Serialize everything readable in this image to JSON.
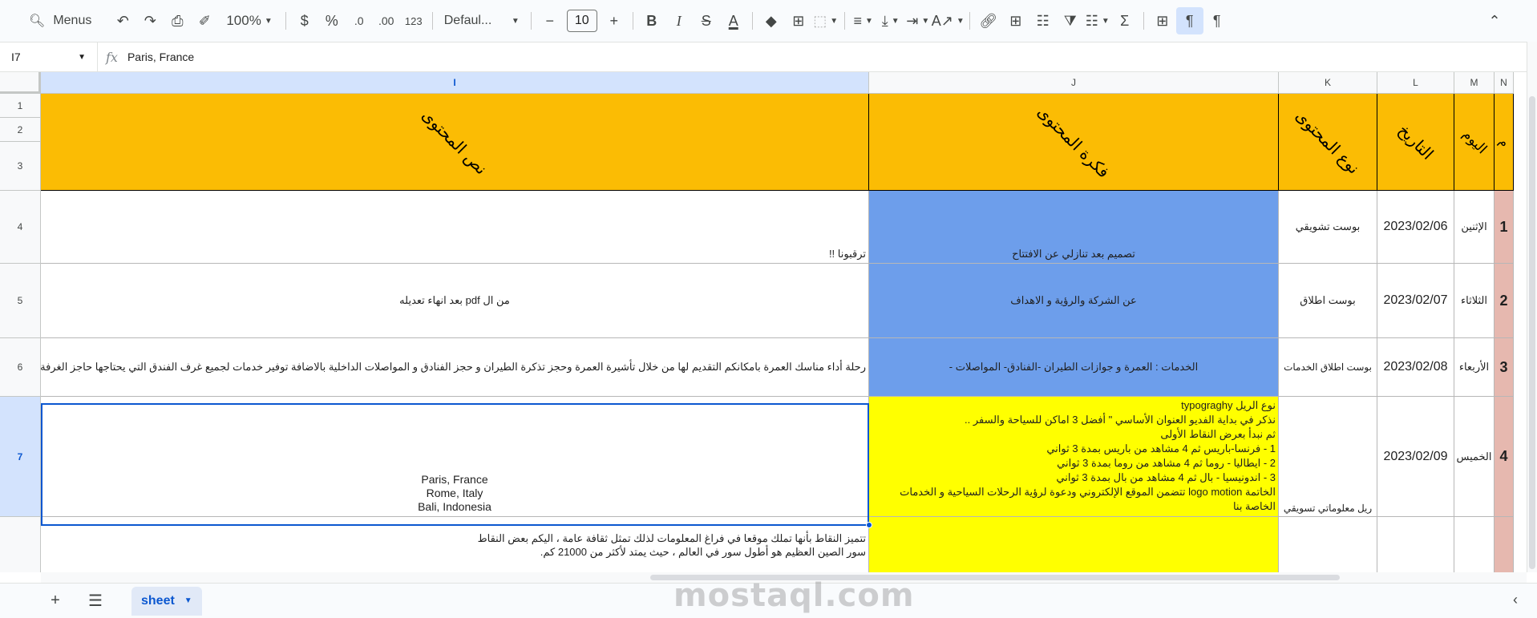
{
  "toolbar": {
    "menus_label": "Menus",
    "zoom": "100%",
    "font": "Defaul...",
    "font_size": "10",
    "currency": "$",
    "percent": "%",
    "dec_decrease": ".0",
    "dec_increase": ".00",
    "number_format": "123"
  },
  "formula_bar": {
    "cell_ref": "I7",
    "fx": "fx",
    "value": "Paris, France"
  },
  "columns": [
    "I",
    "J",
    "K",
    "L",
    "M",
    "N"
  ],
  "rows": [
    "1",
    "2",
    "3",
    "4",
    "5",
    "6",
    "7"
  ],
  "headers": {
    "I": "نص المحتوى",
    "J": "فكرة المحتوى",
    "K": "نوع المحتوى",
    "L": "التاريخ",
    "M": "اليوم",
    "N": "م"
  },
  "table": [
    {
      "I": "ترقبونا !!",
      "J": "تصميم بعد تنازلي  عن الافتتاح",
      "K": "بوست تشويقي",
      "L": "2023/02/06",
      "M": "الإثنين",
      "N": "1"
    },
    {
      "I": "من ال  pdf بعد انهاء تعديله",
      "J": "عن الشركة والرؤية و الاهداف",
      "K": "بوست اطلاق",
      "L": "2023/02/07",
      "M": "الثلاثاء",
      "N": "2"
    },
    {
      "I": "رحلة أداء مناسك العمرة بامكانكم التقديم لها من خلال تأشيرة العمرة وحجز تذكرة الطيران و حجز الفنادق و المواصلات الداخلية بالاضافة توفير خدمات لجميع غرف الفندق التي يحتاجها حاجز الغرفة بالاضافة لتوفير المو",
      "J": "الخدمات : العمرة و جوازات الطيران -الفنادق- المواصلات -",
      "K": "بوست اطلاق الخدمات",
      "L": "2023/02/08",
      "M": "الأربعاء",
      "N": "3"
    },
    {
      "I": "Paris, France\nRome, Italy\nBali, Indonesia",
      "J": "نوع الريل typograghy\nنذكر في بداية الفديو العنوان الأساسي \" أفضل 3 اماكن للسياحة والسفر ..\nثم نبدأ بعرض النقاط الأولى\n1 - فرنسا-باريس ثم 4 مشاهد من باريس  بمدة 3 ثواني\n2 - ايطاليا - روما ثم 4 مشاهد من روما بمدة 3 ثواني\n3 - اندونيسيا - بال ثم 4 مشاهد من بال بمدة 3 ثواني\nالخاتمة logo motion تتضمن الموقع الإلكتروني ودعوة لرؤية الرحلات السياحية و الخدمات الخاصة بنا",
      "K": "ريل  معلوماتي تسويقي",
      "L": "2023/02/09",
      "M": "الخميس",
      "N": "4"
    },
    {
      "I": "تتميز النقاط بأنها تملك موقعا في فراغ المعلومات لذلك تمثل ثقافة عامة ، اليكم بعض النقاط\nسور الصين العظيم هو أطول سور في العالم ، حيث يمتد لأكثر من 21000 كم.",
      "J": "",
      "K": "",
      "L": "",
      "M": "",
      "N": ""
    }
  ],
  "sheet_tab": "sheet",
  "watermark": "mostaql.com",
  "colors": {
    "header_orange": "#fbbc04",
    "blue_cell": "#6d9eeb",
    "yellow_cell": "#ffff00",
    "pink_cell": "#e6b8af",
    "selection": "#0b57d0"
  }
}
